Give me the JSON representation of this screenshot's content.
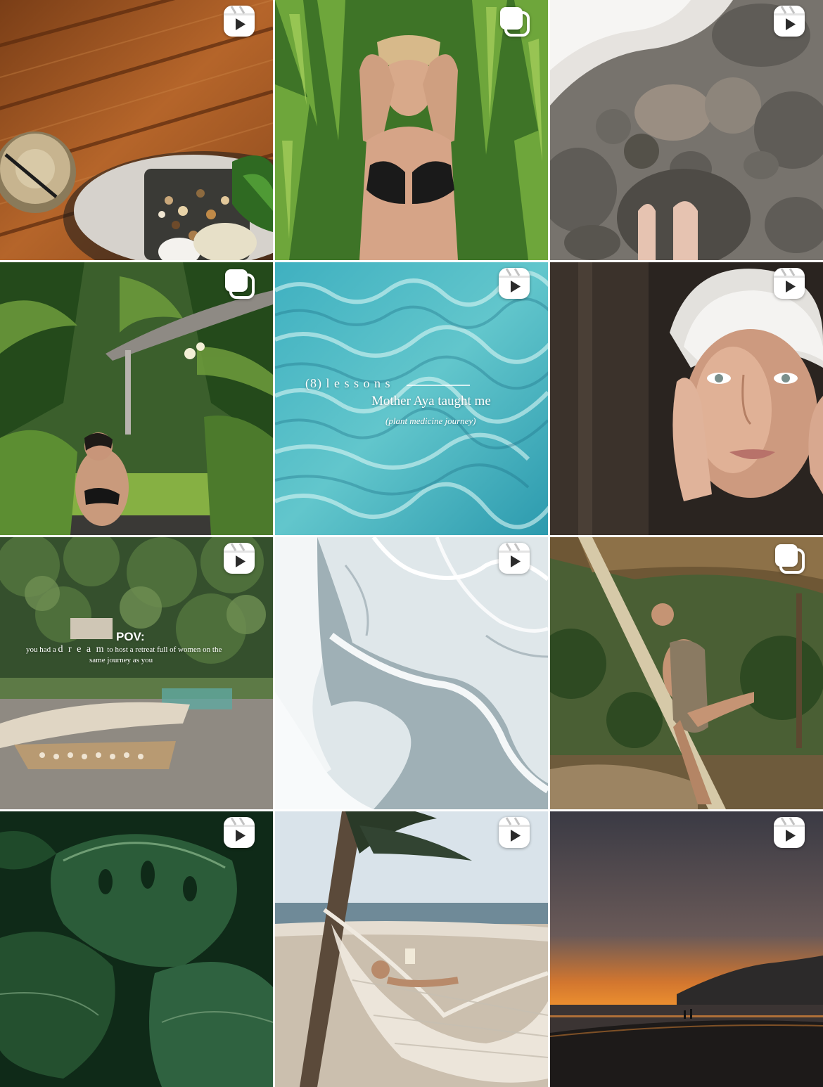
{
  "grid": {
    "tiles": [
      {
        "id": "wood-coconut-bowl",
        "type": "reel",
        "palette": [
          "#8a4b1f",
          "#b86a2c",
          "#d9cfbf"
        ]
      },
      {
        "id": "woman-jungle-bikini",
        "type": "carousel",
        "palette": [
          "#3f7a2a",
          "#79ad3f",
          "#c89a7a"
        ]
      },
      {
        "id": "feet-on-stones",
        "type": "reel",
        "palette": [
          "#6f6c66",
          "#9a948b",
          "#d8d5d1"
        ]
      },
      {
        "id": "garden-shower",
        "type": "carousel",
        "palette": [
          "#2e4f24",
          "#5d8a35",
          "#a8c46a"
        ]
      },
      {
        "id": "pool-water-lessons",
        "type": "reel",
        "palette": [
          "#2f9fb3",
          "#7fd3d8",
          "#d6f2f0"
        ],
        "overlay": {
          "line1": "(8) l e s s o n s",
          "line2": "Mother Aya taught me",
          "line3": "(plant medicine journey)"
        }
      },
      {
        "id": "towel-face-portrait",
        "type": "reel",
        "palette": [
          "#2a2420",
          "#c7957a",
          "#e8e6e3"
        ]
      },
      {
        "id": "retreat-aerial",
        "type": "reel",
        "palette": [
          "#34502c",
          "#6f8a55",
          "#9b968e"
        ],
        "overlay": {
          "title": "POV:",
          "line1_pre": "you had a",
          "line1_word": "d r e a m",
          "line1_post": "to host a retreat full of women on the",
          "line2": "same journey as you"
        }
      },
      {
        "id": "sand-ocean-aerial",
        "type": "reel",
        "palette": [
          "#e7eef1",
          "#b6c6cc",
          "#7f9299"
        ]
      },
      {
        "id": "woman-tree-pose",
        "type": "carousel",
        "palette": [
          "#5c4a2e",
          "#8a7450",
          "#3e5b2a"
        ]
      },
      {
        "id": "monstera-leaves",
        "type": "reel",
        "palette": [
          "#0f2d1a",
          "#255536",
          "#3f7a4f"
        ]
      },
      {
        "id": "beach-hammock",
        "type": "reel",
        "palette": [
          "#b8c9d6",
          "#d8cfc2",
          "#8f7e6c"
        ]
      },
      {
        "id": "beach-sunset",
        "type": "reel",
        "palette": [
          "#3b3b45",
          "#e07a2a",
          "#1c1a1a"
        ]
      }
    ]
  },
  "icons": {
    "reel": "reel-icon",
    "carousel": "carousel-icon"
  }
}
